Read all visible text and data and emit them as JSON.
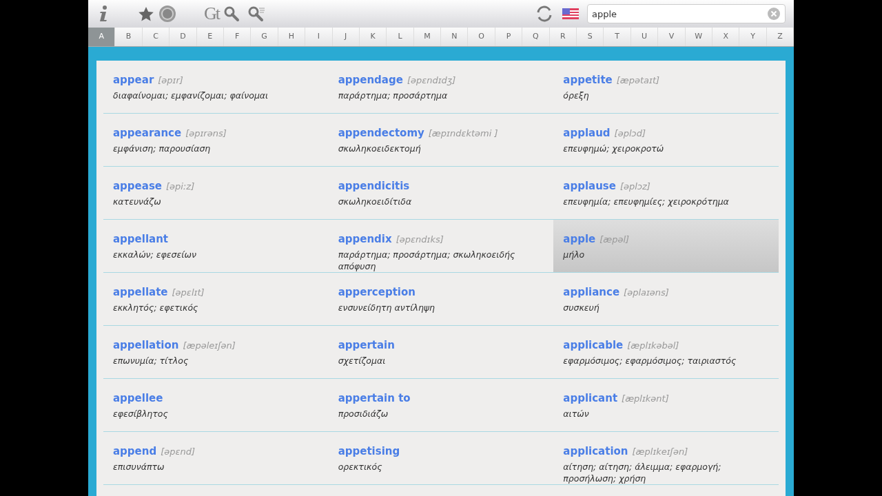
{
  "toolbar": {
    "logo_text": "Gt",
    "search": {
      "value": "apple"
    }
  },
  "letters": [
    {
      "label": "A",
      "selected": true
    },
    {
      "label": "B",
      "selected": false
    },
    {
      "label": "C",
      "selected": false
    },
    {
      "label": "D",
      "selected": false
    },
    {
      "label": "E",
      "selected": false
    },
    {
      "label": "F",
      "selected": false
    },
    {
      "label": "G",
      "selected": false
    },
    {
      "label": "H",
      "selected": false
    },
    {
      "label": "I",
      "selected": false
    },
    {
      "label": "J",
      "selected": false
    },
    {
      "label": "K",
      "selected": false
    },
    {
      "label": "L",
      "selected": false
    },
    {
      "label": "M",
      "selected": false
    },
    {
      "label": "N",
      "selected": false
    },
    {
      "label": "O",
      "selected": false
    },
    {
      "label": "P",
      "selected": false
    },
    {
      "label": "Q",
      "selected": false
    },
    {
      "label": "R",
      "selected": false
    },
    {
      "label": "S",
      "selected": false
    },
    {
      "label": "T",
      "selected": false
    },
    {
      "label": "U",
      "selected": false
    },
    {
      "label": "V",
      "selected": false
    },
    {
      "label": "W",
      "selected": false
    },
    {
      "label": "X",
      "selected": false
    },
    {
      "label": "Y",
      "selected": false
    },
    {
      "label": "Z",
      "selected": false
    }
  ],
  "columns": [
    {
      "entries": [
        {
          "word": "appear",
          "pronunciation": "[əpɪr]",
          "translation": "διαφαίνομαι; εμφανίζομαι; φαίνομαι",
          "selected": false
        },
        {
          "word": "appearance",
          "pronunciation": "[əpɪrəns]",
          "translation": "εμφάνιση; παρουσίαση",
          "selected": false
        },
        {
          "word": "appease",
          "pronunciation": "[əpiːz]",
          "translation": "κατευνάζω",
          "selected": false
        },
        {
          "word": "appellant",
          "translation": "εκκαλών; εφεσείων",
          "selected": false
        },
        {
          "word": "appellate",
          "pronunciation": "[əpɛlɪt]",
          "translation": "εκκλητός; εφετικός",
          "selected": false
        },
        {
          "word": "appellation",
          "pronunciation": "[æpəleɪʃən]",
          "translation": "επωνυμία; τίτλος",
          "selected": false
        },
        {
          "word": "appellee",
          "translation": "εφεσίβλητος",
          "selected": false
        },
        {
          "word": "append",
          "pronunciation": "[əpɛnd]",
          "translation": "επισυνάπτω",
          "selected": false
        }
      ]
    },
    {
      "entries": [
        {
          "word": "appendage",
          "pronunciation": "[əpɛndɪdʒ]",
          "translation": "παράρτημα; προσάρτημα",
          "selected": false
        },
        {
          "word": "appendectomy",
          "pronunciation": "[æpɪndɛktəmi ]",
          "translation": "σκωληκοειδεκτομή",
          "selected": false
        },
        {
          "word": "appendicitis",
          "translation": "σκωληκοειδίτιδα",
          "selected": false
        },
        {
          "word": "appendix",
          "pronunciation": "[əpɛndɪks]",
          "translation": "παράρτημα; προσάρτημα; σκωληκοειδής απόφυση",
          "selected": false
        },
        {
          "word": "apperception",
          "translation": "ενσυνείδητη αντίληψη",
          "selected": false
        },
        {
          "word": "appertain",
          "translation": "σχετίζομαι",
          "selected": false
        },
        {
          "word": "appertain to",
          "translation": "προσιδιάζω",
          "selected": false
        },
        {
          "word": "appetising",
          "translation": "ορεκτικός",
          "selected": false
        }
      ]
    },
    {
      "entries": [
        {
          "word": "appetite",
          "pronunciation": "[æpətaɪt]",
          "translation": "όρεξη",
          "selected": false
        },
        {
          "word": "applaud",
          "pronunciation": "[əplɔd]",
          "translation": "επευφημώ; χειροκροτώ",
          "selected": false
        },
        {
          "word": "applause",
          "pronunciation": "[əplɔz]",
          "translation": "επευφημία; επευφημίες; χειροκρότημα",
          "selected": false
        },
        {
          "word": "apple",
          "pronunciation": "[æpəl]",
          "translation": "μήλο",
          "selected": true
        },
        {
          "word": "appliance",
          "pronunciation": "[əplaɪəns]",
          "translation": "συσκευή",
          "selected": false
        },
        {
          "word": "applicable",
          "pronunciation": "[æplɪkəbəl]",
          "translation": "εφαρμόσιμος; εφαρμόσιμος; ταιριαστός",
          "selected": false
        },
        {
          "word": "applicant",
          "pronunciation": "[æplɪkənt]",
          "translation": "αιτών",
          "selected": false
        },
        {
          "word": "application",
          "pronunciation": "[æplɪkeɪʃən]",
          "translation": "αίτηση; αίτηση; άλειμμα; εφαρμογή; προσήλωση; χρήση",
          "selected": false
        }
      ]
    }
  ]
}
